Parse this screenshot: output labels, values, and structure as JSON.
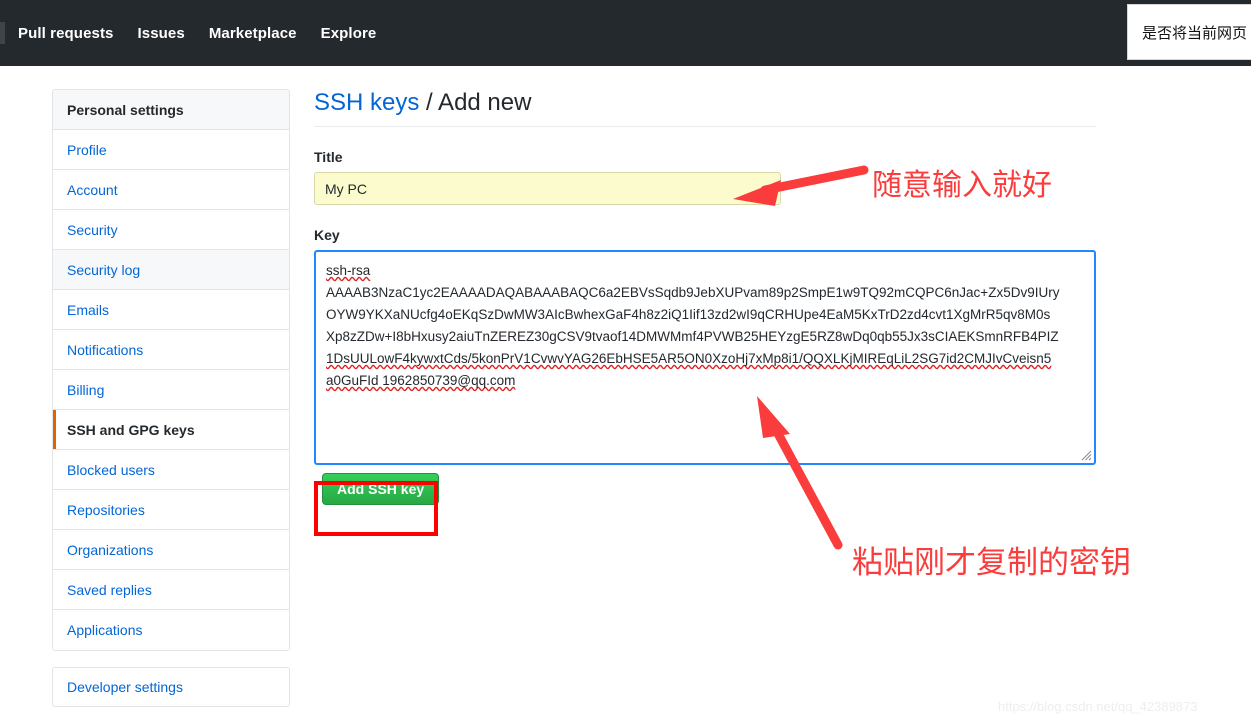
{
  "header": {
    "nav_items": [
      {
        "label": "Pull requests"
      },
      {
        "label": "Issues"
      },
      {
        "label": "Marketplace"
      },
      {
        "label": "Explore"
      }
    ]
  },
  "browser_popup": {
    "text": "是否将当前网页"
  },
  "sidebar": {
    "heading": "Personal settings",
    "items": [
      {
        "label": "Profile",
        "state": "normal"
      },
      {
        "label": "Account",
        "state": "normal"
      },
      {
        "label": "Security",
        "state": "normal"
      },
      {
        "label": "Security log",
        "state": "shaded"
      },
      {
        "label": "Emails",
        "state": "normal"
      },
      {
        "label": "Notifications",
        "state": "normal"
      },
      {
        "label": "Billing",
        "state": "normal"
      },
      {
        "label": "SSH and GPG keys",
        "state": "active"
      },
      {
        "label": "Blocked users",
        "state": "normal"
      },
      {
        "label": "Repositories",
        "state": "normal"
      },
      {
        "label": "Organizations",
        "state": "normal"
      },
      {
        "label": "Saved replies",
        "state": "normal"
      },
      {
        "label": "Applications",
        "state": "normal"
      }
    ],
    "developer_settings": "Developer settings"
  },
  "main": {
    "title_link": "SSH keys",
    "title_rest": " / Add new",
    "title_field_label": "Title",
    "title_field_value": "My PC",
    "title_field_placeholder": "",
    "key_field_label": "Key",
    "key_field_placeholder": "",
    "key_lines": [
      "ssh-rsa",
      "AAAAB3NzaC1yc2EAAAADAQABAAABAQC6a2EBVsSqdb9JebXUPvam89p2SmpE1w9TQ92mCQPC6nJac+Zx5Dv9IUry",
      "OYW9YKXaNUcfg4oEKqSzDwMW3AIcBwhexGaF4h8z2iQ1Iif13zd2wI9qCRHUpe4EaM5KxTrD2zd4cvt1XgMrR5qv8M0s",
      "Xp8zZDw+I8bHxusy2aiuTnZEREZ30gCSV9tvaof14DMWMmf4PVWB25HEYzgE5RZ8wDq0qb55Jx3sCIAEKSmnRFB4PIZ",
      "1DsUULowF4kywxtCds/5konPrV1CvwvYAG26EbHSE5AR5ON0XzoHj7xMp8i1/QQXLKjMIREqLiL2SG7id2CMJIvCveisn5",
      "a0GuFId 1962850739@qq.com"
    ],
    "submit_label": "Add SSH key"
  },
  "annotations": {
    "title_note": "随意输入就好",
    "key_note": "粘贴刚才复制的密钥",
    "color": "#fa3c3c",
    "highlight_color": "#ff0000"
  },
  "watermark": "https://blog.csdn.net/qq_42389873",
  "colors": {
    "header_bg": "#24292e",
    "link_blue": "#0366d6",
    "active_orange": "#e36209",
    "button_green": "#28a745",
    "focus_blue": "#2188ff",
    "autofill_yellow": "#fbfbce"
  }
}
